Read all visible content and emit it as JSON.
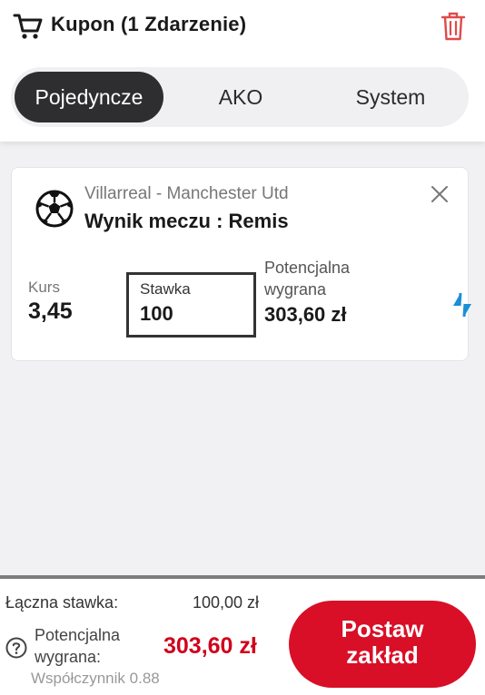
{
  "header": {
    "title": "Kupon (1 Zdarzenie)",
    "cart_icon": "shopping-cart-icon",
    "trash_icon": "trash-icon"
  },
  "tabs": [
    {
      "label": "Pojedyncze",
      "active": true
    },
    {
      "label": "AKO",
      "active": false
    },
    {
      "label": "System",
      "active": false
    }
  ],
  "bet": {
    "event": "Villarreal - Manchester Utd",
    "market": "Wynik meczu : Remis",
    "odds_label": "Kurs",
    "odds_value": "3,45",
    "stake_label": "Stawka",
    "stake_value": "100",
    "potential_label": "Potencjalna wygrana",
    "potential_value": "303,60 zł",
    "sport_icon": "soccer-ball-icon",
    "close_icon": "close-icon",
    "switch_icon": "switch-arrows-icon"
  },
  "footer": {
    "total_label": "Łączna stawka:",
    "total_value": "100,00 zł",
    "potential_label": "Potencjalna wygrana:",
    "potential_value": "303,60 zł",
    "coefficient": "Współczynnik 0.88",
    "place_button_line1": "Postaw",
    "place_button_line2": "zakład",
    "info_icon": "info-icon"
  },
  "colors": {
    "accent_red": "#d80f27",
    "potential_red": "#d0021b",
    "tab_active_bg": "#2e2e30",
    "switch_blue": "#1a8fd6"
  }
}
